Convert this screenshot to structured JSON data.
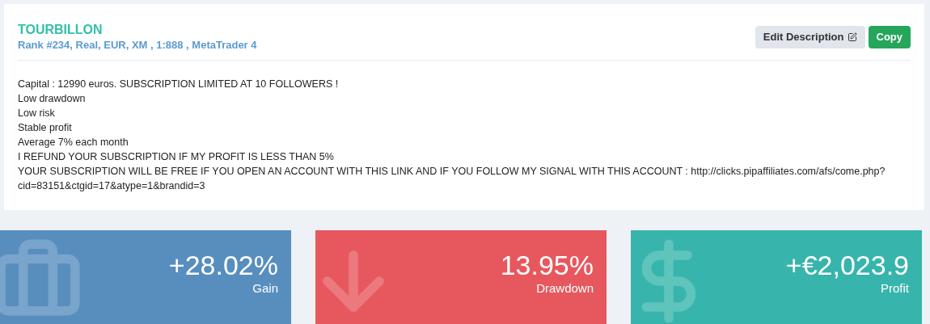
{
  "header": {
    "title": "TOURBILLON",
    "subtitle": "Rank #234, Real, EUR, XM , 1:888 , MetaTrader 4"
  },
  "buttons": [
    {
      "label": "Edit Description",
      "kind": "edit"
    },
    {
      "label": "Copy",
      "kind": "copy"
    }
  ],
  "description": [
    "Capital : 12990 euros. SUBSCRIPTION LIMITED AT 10 FOLLOWERS !",
    "Low drawdown",
    "Low risk",
    "Stable profit",
    "Average 7% each month",
    "I REFUND YOUR SUBSCRIPTION IF MY PROFIT IS LESS THAN 5%",
    "YOUR SUBSCRIPTION WILL BE FREE IF YOU OPEN AN ACCOUNT WITH THIS LINK AND IF YOU FOLLOW MY SIGNAL WITH THIS ACCOUNT : http://clicks.pipaffiliates.com/afs/come.php?cid=83151&ctgid=17&atype=1&brandid=3"
  ],
  "stats": [
    {
      "kind": "gain",
      "value": "+28.02%",
      "label": "Gain",
      "color": "#578ebe"
    },
    {
      "kind": "drawdown",
      "value": "13.95%",
      "label": "Drawdown",
      "color": "#e7585e"
    },
    {
      "kind": "profit",
      "value": "+€2,023.9",
      "label": "Profit",
      "color": "#37b5ac"
    }
  ]
}
